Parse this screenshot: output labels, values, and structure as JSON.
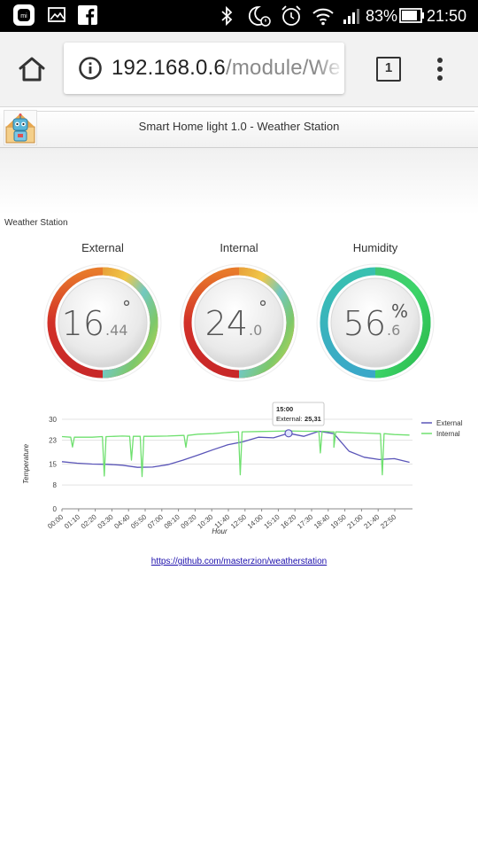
{
  "statusbar": {
    "battery": "83%",
    "time": "21:50"
  },
  "browser": {
    "url_host": "192.168.0.6",
    "url_path": "/module/We",
    "tab_count": "1"
  },
  "page": {
    "title": "Smart Home light 1.0 - Weather Station",
    "section_label": "Weather Station",
    "footer_link": "https://github.com/masterzion/weatherstation"
  },
  "gauges": [
    {
      "title": "External",
      "whole": "16",
      "fraction": ".44",
      "unit": "°",
      "value": 16.44,
      "ring": "temperature"
    },
    {
      "title": "Internal",
      "whole": "24",
      "fraction": ".0",
      "unit": "°",
      "value": 24.0,
      "ring": "temperature"
    },
    {
      "title": "Humidity",
      "whole": "56",
      "fraction": ".6",
      "unit": "%",
      "value": 56.6,
      "ring": "humidity"
    }
  ],
  "chart_data": {
    "type": "line",
    "xlabel": "Hour",
    "ylabel": "Temperature",
    "ylim": [
      0,
      30
    ],
    "yticks": [
      0,
      8,
      15,
      23,
      30
    ],
    "xticks": [
      "00:00",
      "01:10",
      "02:20",
      "03:30",
      "04:40",
      "05:50",
      "07:00",
      "08:10",
      "09:20",
      "10:30",
      "11:40",
      "12:50",
      "14:00",
      "15:10",
      "16:20",
      "17:30",
      "18:40",
      "19:50",
      "21:00",
      "21:40",
      "22:50"
    ],
    "legend": "right",
    "grid": true,
    "tooltip": {
      "time": "15:00",
      "series": "External",
      "value": "25,31"
    },
    "series": [
      {
        "name": "External",
        "color": "#5a55b8",
        "x": [
          0,
          1,
          2,
          3,
          4,
          5,
          6,
          7,
          8,
          9,
          10,
          11,
          12,
          13,
          14,
          15,
          16,
          17,
          18,
          19,
          20,
          21,
          22,
          23
        ],
        "values": [
          15.8,
          15.3,
          15.0,
          14.9,
          14.6,
          13.9,
          14.0,
          14.8,
          16.3,
          18.0,
          19.8,
          21.5,
          22.5,
          24.0,
          23.8,
          25.3,
          24.3,
          26.0,
          25.2,
          19.3,
          17.3,
          16.5,
          16.8,
          15.6
        ]
      },
      {
        "name": "Internal",
        "color": "#6fe06f",
        "x": [
          0,
          1,
          2,
          3,
          4,
          5,
          6,
          7,
          8,
          9,
          10,
          11,
          12,
          13,
          14,
          15,
          16,
          17,
          18,
          19,
          20,
          21,
          22,
          23
        ],
        "values": [
          24.2,
          24.0,
          24.0,
          24.2,
          24.4,
          24.3,
          24.3,
          24.4,
          24.6,
          25.0,
          25.2,
          25.6,
          25.8,
          25.9,
          26.0,
          26.1,
          26.0,
          26.0,
          25.8,
          25.6,
          25.4,
          25.2,
          24.9,
          24.7
        ],
        "dips": [
          {
            "x": 0.7,
            "value": 20.7
          },
          {
            "x": 2.8,
            "value": 11.0
          },
          {
            "x": 4.6,
            "value": 16.3
          },
          {
            "x": 5.3,
            "value": 10.8
          },
          {
            "x": 8.2,
            "value": 20.6
          },
          {
            "x": 11.8,
            "value": 11.4
          },
          {
            "x": 17.1,
            "value": 18.7
          },
          {
            "x": 18.0,
            "value": 20.6
          },
          {
            "x": 21.2,
            "value": 11.4
          }
        ]
      }
    ]
  }
}
